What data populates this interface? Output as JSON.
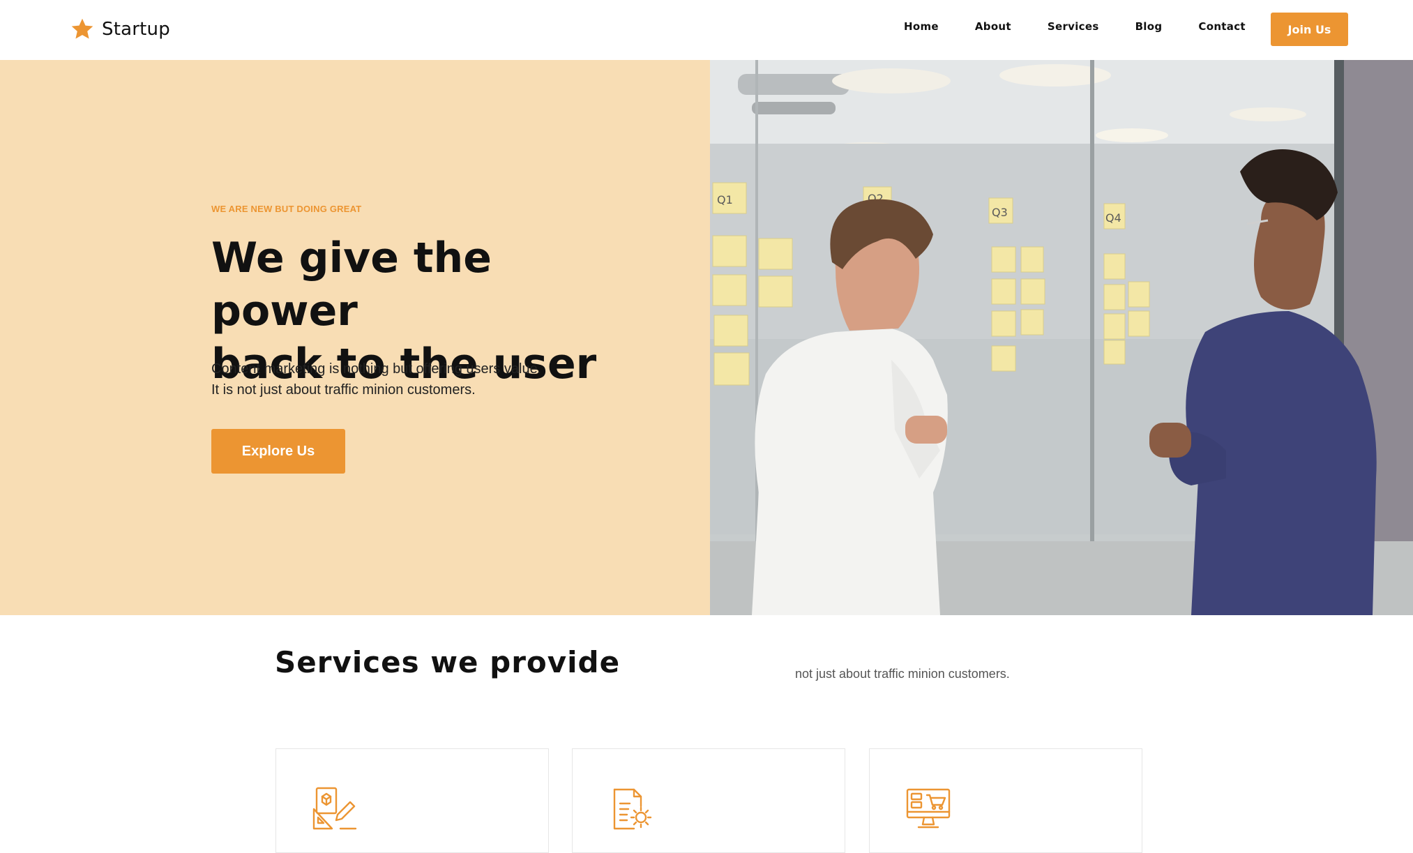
{
  "brand": {
    "name": "Startup",
    "accent": "#ec9532",
    "hero_bg": "#f8ddb4"
  },
  "nav": {
    "links": [
      "Home",
      "About",
      "Services",
      "Blog",
      "Contact"
    ],
    "cta": "Join Us"
  },
  "hero": {
    "eyebrow": "WE ARE NEW BUT DOING GREAT",
    "title_line1": "We give the power",
    "title_line2": "back to the user",
    "sub_line1": "Content marketing is nothing but offering users value.",
    "sub_line2": "It is not just about traffic minion customers.",
    "cta": "Explore Us",
    "photo": {
      "icon": "team-whiteboard-photo",
      "notes": [
        "Q1",
        "Q2",
        "Q3",
        "Q4"
      ]
    }
  },
  "services": {
    "title": "Services we provide",
    "subtitle": "not just about traffic minion customers.",
    "cards": [
      {
        "icon": "design-tools-icon"
      },
      {
        "icon": "document-settings-icon"
      },
      {
        "icon": "ecommerce-monitor-icon"
      }
    ]
  }
}
